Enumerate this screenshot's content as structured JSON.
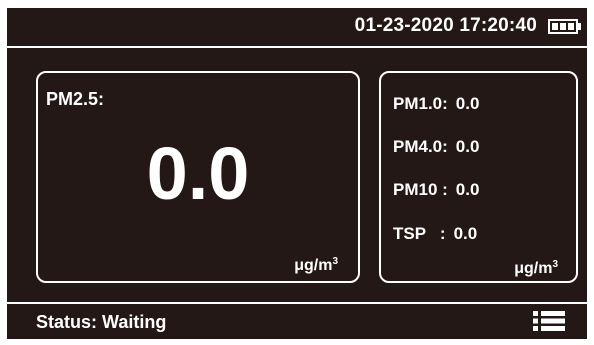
{
  "header": {
    "datetime": "01-23-2020 17:20:40",
    "battery_icon": "battery-full-icon"
  },
  "main_panel": {
    "label": "PM2.5:",
    "value": "0.0",
    "unit_base": "μg/m",
    "unit_exp": "3"
  },
  "side_panel": {
    "readings": [
      {
        "label": "PM1.0:",
        "value": "0.0"
      },
      {
        "label": "PM4.0:",
        "value": "0.0"
      },
      {
        "label": "PM10 :",
        "value": "0.0"
      },
      {
        "label": "TSP   :",
        "value": "0.0"
      }
    ],
    "unit_base": "μg/m",
    "unit_exp": "3"
  },
  "footer": {
    "status": "Status: Waiting",
    "menu_icon": "list-menu-icon"
  },
  "colors": {
    "background": "#231815",
    "foreground": "#ffffff",
    "page": "#ffffff"
  }
}
